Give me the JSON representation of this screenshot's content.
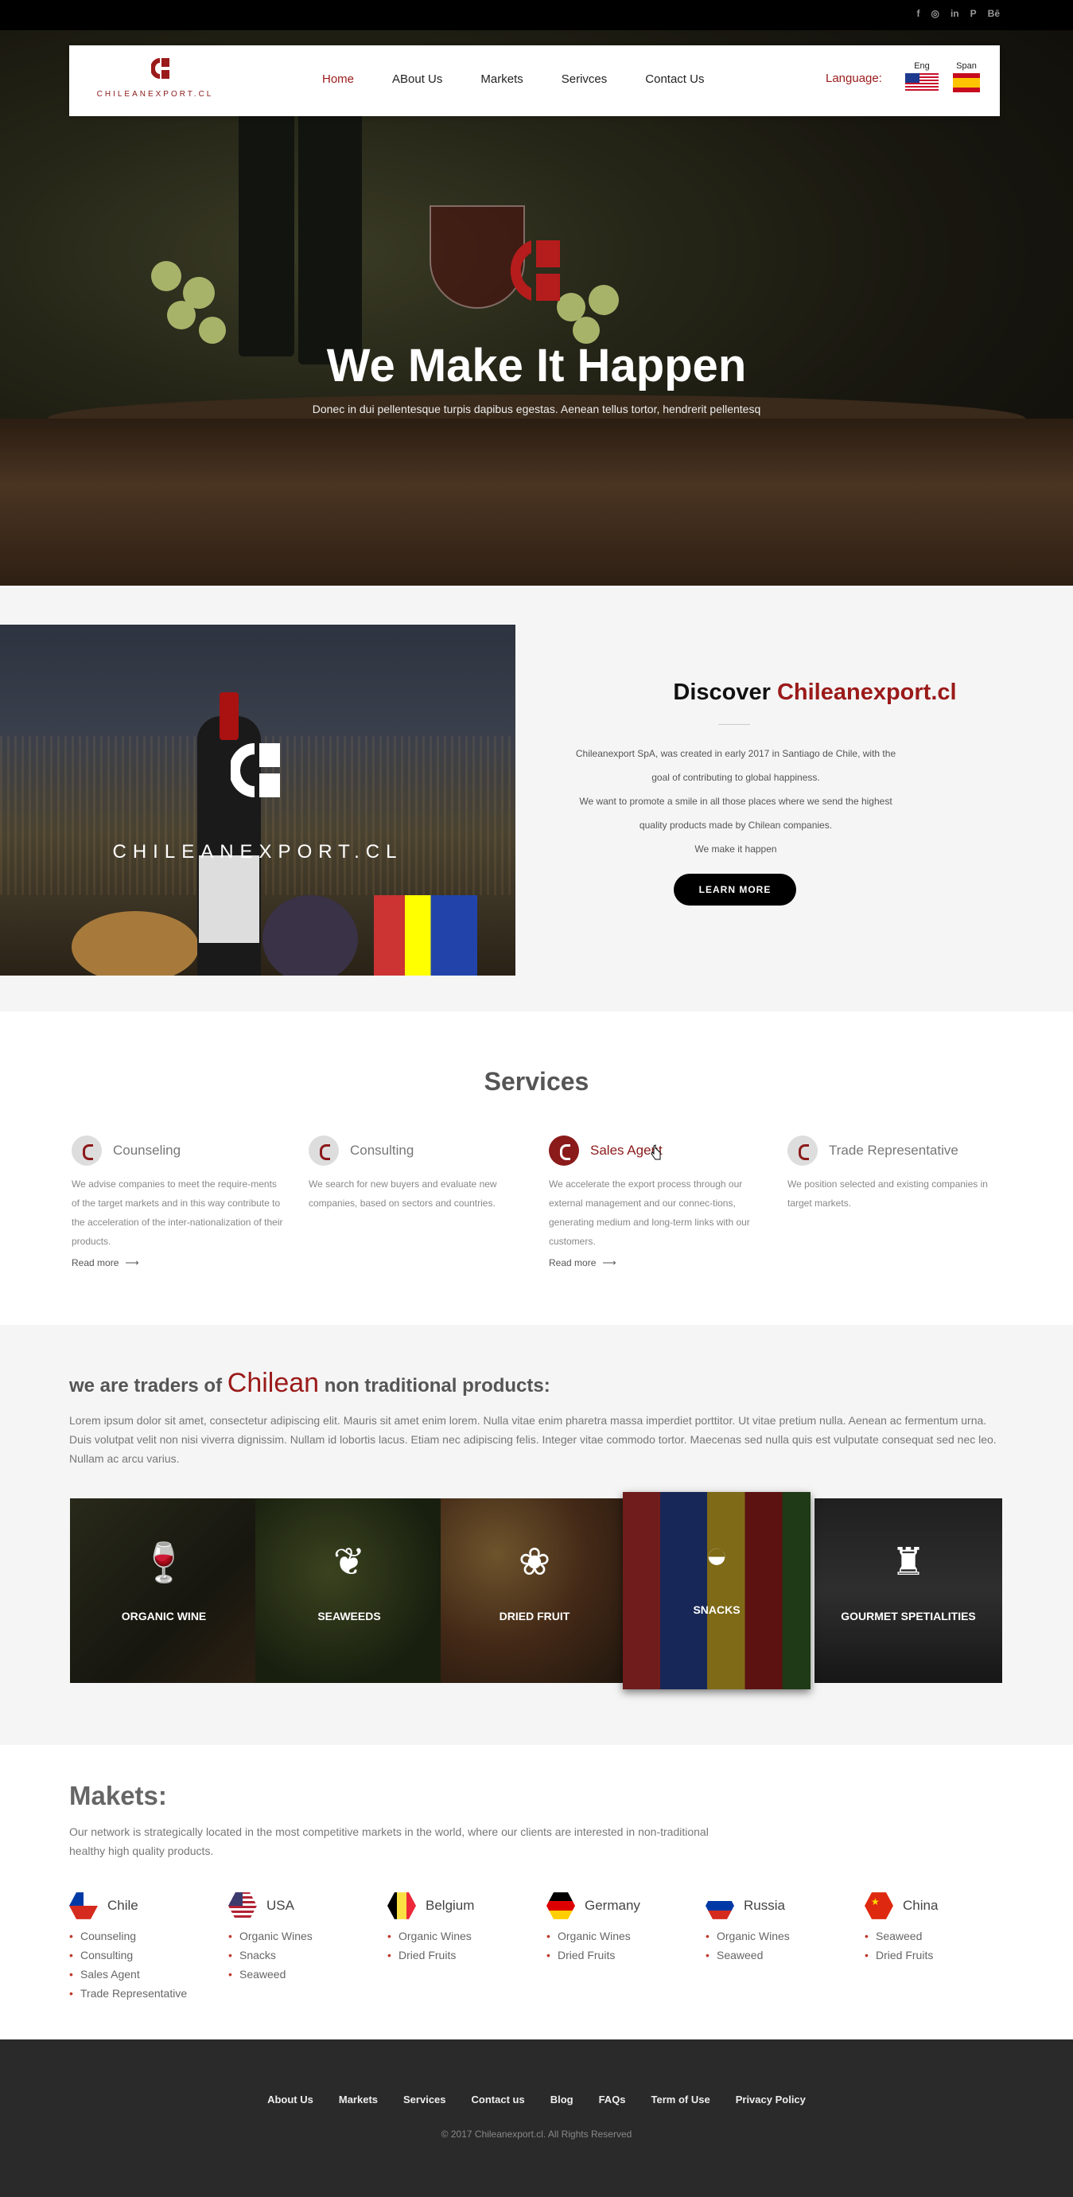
{
  "social": [
    "f",
    "◎",
    "in",
    "P",
    "Bē"
  ],
  "nav": {
    "brand": "CHILEANEXPORT.CL",
    "items": [
      "Home",
      "ABout Us",
      "Markets",
      "Serivces",
      "Contact Us"
    ],
    "language_label": "Language:",
    "languages": [
      "Eng",
      "Span"
    ]
  },
  "hero": {
    "title": "We Make It Happen",
    "subtitle": "Donec in dui pellentesque turpis dapibus egestas. Aenean tellus tortor, hendrerit pellentesq"
  },
  "discover": {
    "brand": "CHILEANEXPORT.CL",
    "title_prefix": "Discover",
    "title_highlight": "Chileanexport.cl",
    "lines": [
      "Chileanexport SpA, was created in early 2017 in Santiago de Chile, with the",
      "goal of contributing to global happiness.",
      "We want to promote a smile in all those places where we send the highest",
      "quality products   made by Chilean companies.",
      "We make it happen"
    ],
    "button": "LEARN MORE"
  },
  "services": {
    "title": "Services",
    "items": [
      {
        "name": "Counseling",
        "desc": "We advise companies to meet the require-ments of the target markets and in this way contribute to the acceleration of the inter-nationalization of their products.",
        "read_more": "Read more"
      },
      {
        "name": "Consulting",
        "desc": "We search for new buyers and evaluate new companies, based on sectors and countries.",
        "read_more": ""
      },
      {
        "name": "Sales Agent",
        "desc": "We accelerate the export process through our external management and our connec-tions, generating medium and long-term links with our customers.",
        "read_more": "Read more"
      },
      {
        "name": "Trade Representative",
        "desc": "We position  selected and  existing companies in  target markets.",
        "read_more": ""
      }
    ]
  },
  "traders": {
    "title_prefix": "we are traders of",
    "title_highlight": "Chilean",
    "title_suffix": "non traditional products:",
    "text": "Lorem ipsum dolor sit amet, consectetur adipiscing elit. Mauris sit amet enim lorem. Nulla vitae enim pharetra massa imperdiet porttitor. Ut vitae pretium nulla. Aenean ac fermentum urna. Duis volutpat velit non nisi viverra dignissim. Nullam id lobortis lacus. Etiam nec adipiscing felis. Integer vitae commodo tortor. Maecenas sed nulla quis est vulputate consequat sed nec leo. Nullam ac arcu varius.",
    "products": [
      {
        "label": "ORGANIC WINE",
        "icon": "🍷"
      },
      {
        "label": "SEAWEEDS",
        "icon": "❦"
      },
      {
        "label": "DRIED FRUIT",
        "icon": "❀"
      },
      {
        "label": "SNACKS",
        "icon": "◒"
      },
      {
        "label": "GOURMET SPETIALITIES",
        "icon": "♜"
      }
    ]
  },
  "markets": {
    "title": "Makets:",
    "text": "Our network is strategically located in the  most competitive markets in the world, where our clients are interested in non-traditional  healthy  high quality products.",
    "countries": [
      {
        "name": "Chile",
        "items": [
          "Counseling",
          "Consulting",
          "Sales Agent",
          "Trade Representative"
        ]
      },
      {
        "name": "USA",
        "items": [
          "Organic Wines",
          "Snacks",
          "Seaweed"
        ]
      },
      {
        "name": "Belgium",
        "items": [
          "Organic Wines",
          "Dried Fruits"
        ]
      },
      {
        "name": "Germany",
        "items": [
          "Organic Wines",
          "Dried Fruits"
        ]
      },
      {
        "name": "Russia",
        "items": [
          "Organic Wines",
          "Seaweed"
        ]
      },
      {
        "name": "China",
        "items": [
          "Seaweed",
          "Dried Fruits"
        ]
      }
    ]
  },
  "footer": {
    "links": [
      "About Us",
      "Markets",
      "Services",
      "Contact us",
      "Blog",
      "FAQs",
      "Term of Use",
      "Privacy Policy"
    ],
    "copyright": "© 2017 Chileanexport.cl. All Rights Reserved"
  },
  "colors": {
    "accent": "#9b1a1a",
    "footer": "#2a2a2a"
  }
}
